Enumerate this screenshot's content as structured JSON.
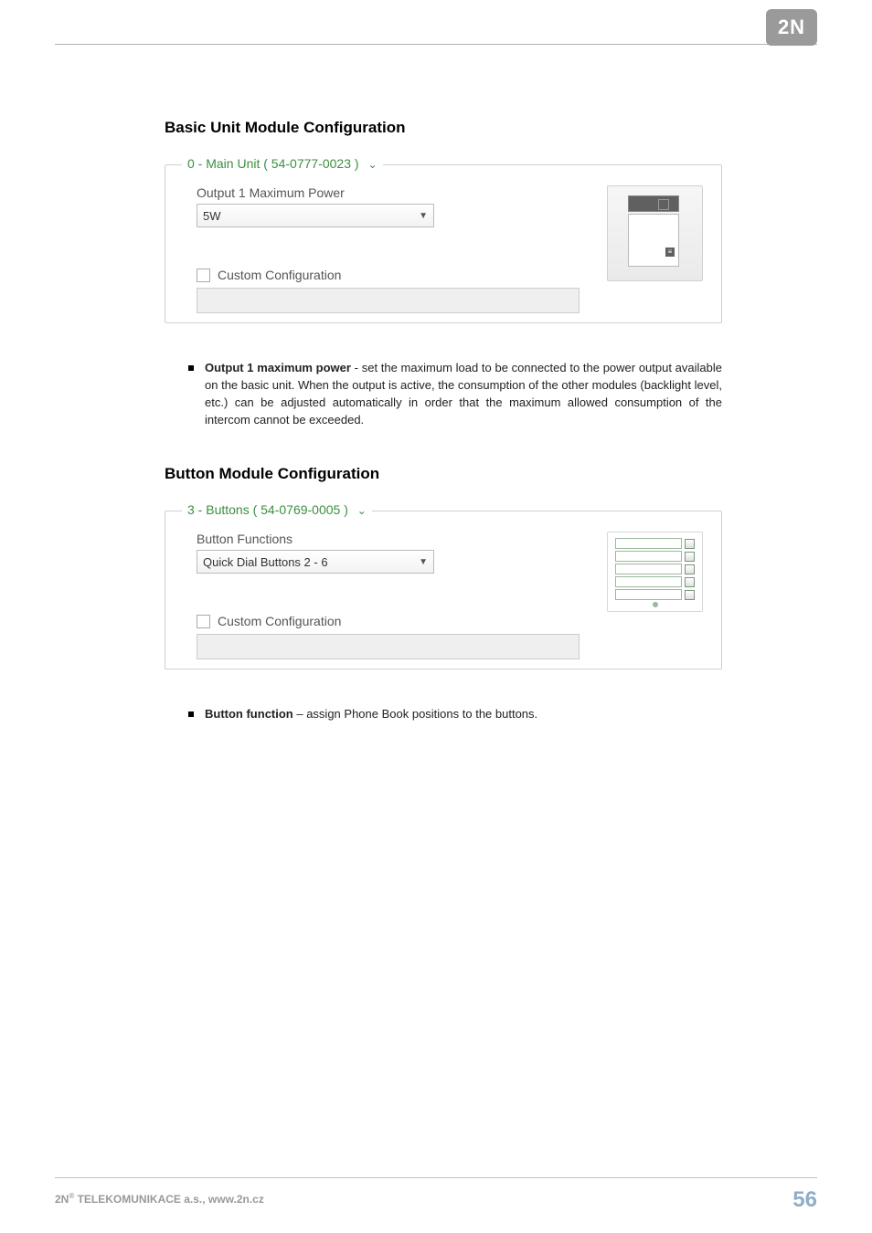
{
  "logo": "2N",
  "section1": {
    "heading": "Basic Unit Module Configuration",
    "legend": "0 - Main Unit ( 54-0777-0023 )",
    "field_label": "Output 1 Maximum Power",
    "field_value": "5W",
    "checkbox_label": "Custom Configuration"
  },
  "bullet1": {
    "term": "Output 1 maximum power",
    "desc": " - set the maximum load to be connected to the power output available on the basic unit. When the output is active, the consumption of the other modules (backlight level, etc.) can be adjusted automatically in order that the maximum allowed consumption of the intercom cannot be exceeded."
  },
  "section2": {
    "heading": "Button Module Configuration",
    "legend": "3 - Buttons ( 54-0769-0005 )",
    "field_label": "Button Functions",
    "field_value": "Quick Dial Buttons 2 - 6",
    "checkbox_label": "Custom Configuration"
  },
  "bullet2": {
    "term": "Button function",
    "desc": " – assign Phone Book positions to the buttons."
  },
  "footer": {
    "company": "2N",
    "rest": " TELEKOMUNIKACE a.s., www.2n.cz",
    "page": "56"
  }
}
